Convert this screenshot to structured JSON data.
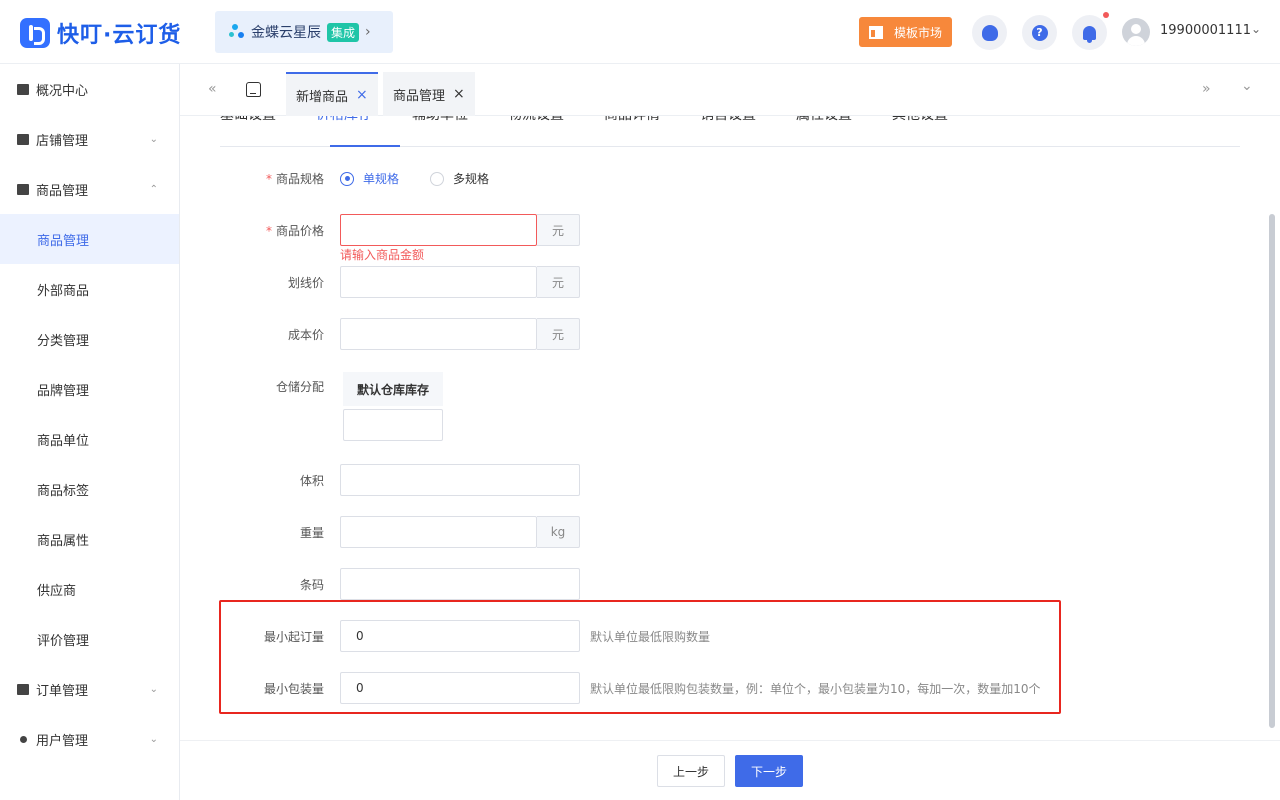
{
  "header": {
    "brand": "快叮·云订货",
    "kingdee": {
      "name": "金蝶云星辰",
      "badge": "集成",
      "chevron": "›"
    },
    "template_market": "模板市场",
    "support_icon": "headset-icon",
    "help_icon": "help-icon",
    "help_glyph": "?",
    "bell_icon": "bell-icon",
    "user": "19900001111",
    "user_chevron": "⌄"
  },
  "sidebar": {
    "groups": [
      {
        "label": "概况中心",
        "icon": "dashboard-icon"
      },
      {
        "label": "店铺管理",
        "icon": "store-icon",
        "chevron": "⌄"
      },
      {
        "label": "商品管理",
        "icon": "goods-icon",
        "chevron": "⌃"
      },
      {
        "label": "订单管理",
        "icon": "order-icon",
        "chevron": "⌄"
      },
      {
        "label": "用户管理",
        "icon": "user-icon",
        "chevron": "⌄"
      }
    ],
    "items": [
      {
        "label": "商品管理",
        "active": true
      },
      {
        "label": "外部商品"
      },
      {
        "label": "分类管理"
      },
      {
        "label": "品牌管理"
      },
      {
        "label": "商品单位"
      },
      {
        "label": "商品标签"
      },
      {
        "label": "商品属性"
      },
      {
        "label": "供应商"
      },
      {
        "label": "评价管理"
      }
    ]
  },
  "tabs": {
    "left_arrows": "«",
    "right_arrows": "»",
    "dropdown": "⌄",
    "items": [
      {
        "label": "新增商品",
        "close": "×",
        "active": true
      },
      {
        "label": "商品管理",
        "close": "×"
      }
    ]
  },
  "subtabs": [
    "基础设置",
    "价格库存",
    "辅助单位",
    "物流设置",
    "商品详情",
    "销售设置",
    "属性设置",
    "其他设置"
  ],
  "subtab_active": 1,
  "form": {
    "spec_label": "商品规格",
    "spec_single": "单规格",
    "spec_multi": "多规格",
    "price_label": "商品价格",
    "price_value": "",
    "price_unit": "元",
    "price_error": "请输入商品金额",
    "list_price_label": "划线价",
    "list_price_unit": "元",
    "cost_label": "成本价",
    "cost_unit": "元",
    "storage_label": "仓储分配",
    "storage_header": "默认仓库库存",
    "volume_label": "体积",
    "weight_label": "重量",
    "weight_unit": "kg",
    "barcode_label": "条码",
    "min_order_label": "最小起订量",
    "min_order_value": "0",
    "min_order_hint": "默认单位最低限购数量",
    "min_pack_label": "最小包装量",
    "min_pack_value": "0",
    "min_pack_hint": "默认单位最低限购包装数量，例：单位个，最小包装量为10，每加一次，数量加10个"
  },
  "footer": {
    "prev": "上一步",
    "next": "下一步"
  },
  "colors": {
    "primary": "#3f6be8",
    "error": "#f25a5a",
    "highlight_box": "#e8261f",
    "template_button": "#f7883b"
  }
}
